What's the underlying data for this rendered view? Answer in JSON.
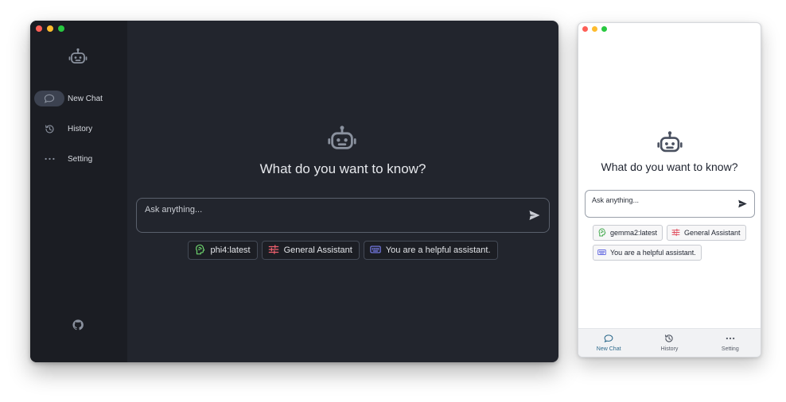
{
  "desktop": {
    "sidebar": {
      "logo_icon": "robot-icon",
      "items": [
        {
          "label": "New Chat",
          "icon": "chat-bubble-icon",
          "active": true
        },
        {
          "label": "History",
          "icon": "history-icon",
          "active": false
        },
        {
          "label": "Setting",
          "icon": "more-dots-icon",
          "active": false
        }
      ],
      "footer_icon": "github-icon"
    },
    "hero_title": "What do you want to know?",
    "input": {
      "placeholder": "Ask anything...",
      "value": ""
    },
    "chips": {
      "model": "phi4:latest",
      "assistant": "General Assistant",
      "prompt": "You are a helpful assistant."
    }
  },
  "mobile": {
    "hero_title": "What do you want to know?",
    "input": {
      "placeholder": "Ask anything...",
      "value": ""
    },
    "chips": {
      "model": "gemma2:latest",
      "assistant": "General Assistant",
      "prompt": "You are a helpful assistant."
    },
    "bottom_nav": [
      {
        "label": "New Chat",
        "icon": "chat-bubble-icon",
        "active": true
      },
      {
        "label": "History",
        "icon": "history-icon",
        "active": false
      },
      {
        "label": "Setting",
        "icon": "more-dots-icon",
        "active": false
      }
    ]
  },
  "colors": {
    "dark_bg": "#22252d",
    "dark_sidebar": "#1b1d23",
    "model_chip_icon": "#6cd16c",
    "assistant_chip_icon": "#f0606e",
    "prompt_chip_icon": "#7a7ff0",
    "mobile_active": "#2d6a8c"
  }
}
